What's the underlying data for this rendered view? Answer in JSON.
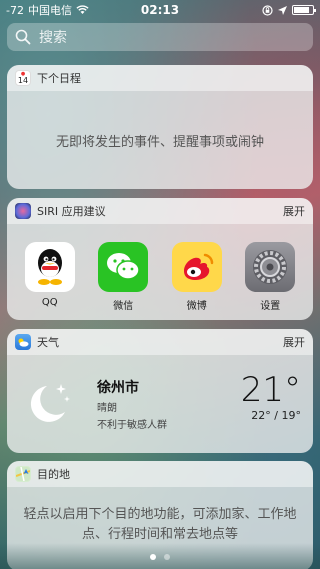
{
  "status_bar": {
    "signal": "-72",
    "carrier": "中国电信",
    "time": "02:13"
  },
  "search": {
    "placeholder": "搜索"
  },
  "calendar_widget": {
    "icon_day": "14",
    "title": "下个日程",
    "empty_message": "无即将发生的事件、提醒事项或闹钟"
  },
  "siri_widget": {
    "title": "SIRI 应用建议",
    "expand": "展开",
    "apps": [
      {
        "label": "QQ",
        "icon": "qq-icon"
      },
      {
        "label": "微信",
        "icon": "wechat-icon"
      },
      {
        "label": "微博",
        "icon": "weibo-icon"
      },
      {
        "label": "设置",
        "icon": "settings-icon"
      }
    ]
  },
  "weather_widget": {
    "title": "天气",
    "expand": "展开",
    "city": "徐州市",
    "condition": "晴朗",
    "note": "不利于敏感人群",
    "temperature": "21°",
    "range": "22° / 19°"
  },
  "destination_widget": {
    "title": "目的地",
    "message": "轻点以启用下个目的地功能，可添加家、工作地点、行程时间和常去地点等"
  },
  "pager": {
    "pages": 2,
    "current": 1
  }
}
